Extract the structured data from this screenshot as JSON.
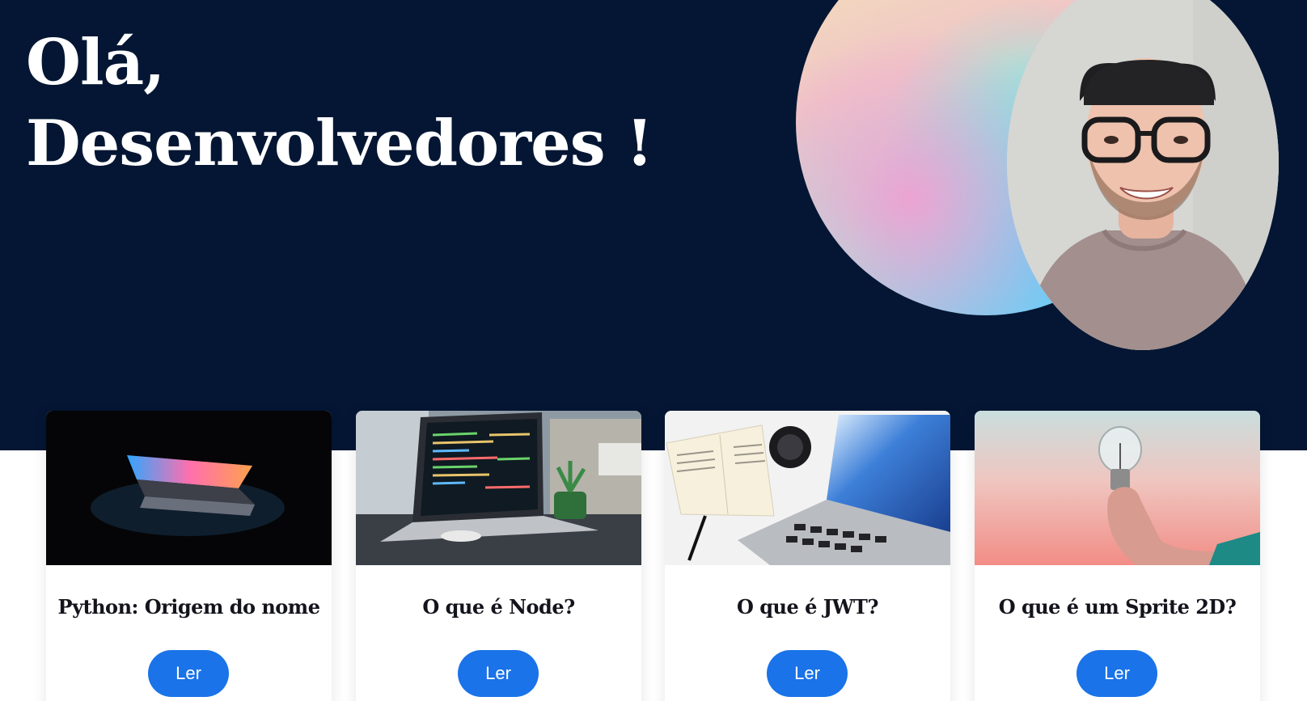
{
  "hero": {
    "greeting_line1": "Olá,",
    "greeting_line2": "Desenvolvedores !"
  },
  "colors": {
    "hero_background": "#041633",
    "button_blue": "#1a73e8",
    "card_background": "#ffffff"
  },
  "cards": [
    {
      "title": "Python: Origem do nome",
      "button_label": "Ler",
      "image": "laptop-dark-glow"
    },
    {
      "title": "O que é Node?",
      "button_label": "Ler",
      "image": "laptop-code-desk"
    },
    {
      "title": "O que é JWT?",
      "button_label": "Ler",
      "image": "laptop-book-camera-lens"
    },
    {
      "title": "O que é um Sprite 2D?",
      "button_label": "Ler",
      "image": "hand-holding-lightbulb"
    }
  ]
}
